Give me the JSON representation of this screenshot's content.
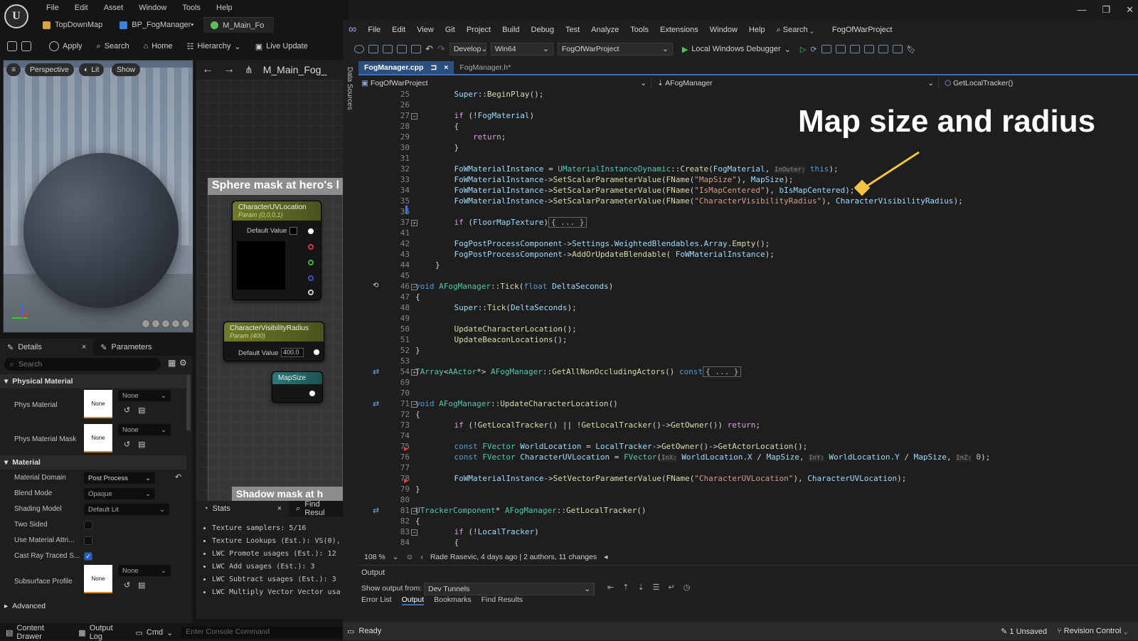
{
  "ue": {
    "menu": [
      "File",
      "Edit",
      "Asset",
      "Window",
      "Tools",
      "Help"
    ],
    "tabs": [
      {
        "label": "TopDownMap"
      },
      {
        "label": "BP_FogManager•"
      },
      {
        "label": "M_Main_Fo"
      }
    ],
    "toolbar": {
      "apply": "Apply",
      "search": "Search",
      "home": "Home",
      "hierarchy": "Hierarchy",
      "live_update": "Live Update"
    },
    "viewport": {
      "perspective": "Perspective",
      "lit": "Lit",
      "show": "Show"
    },
    "graph": {
      "title": "M_Main_Fog_",
      "comment": "Sphere mask at hero's l",
      "nodes": [
        {
          "title": "CharacterUVLocation",
          "sub": "Param (0,0,0,1)",
          "field_label": "Default Value",
          "field_value": ""
        },
        {
          "title": "CharacterVisibilityRadius",
          "sub": "Param (400)",
          "field_label": "Default Value",
          "field_value": "400.0"
        },
        {
          "title": "MapSize",
          "sub": "",
          "field_label": "",
          "field_value": ""
        }
      ],
      "shadow_comment": "Shadow mask at h"
    },
    "details": {
      "tab_details": "Details",
      "tab_parameters": "Parameters",
      "search_placeholder": "Search",
      "physical_material": "Physical Material",
      "phys_material": "Phys Material",
      "phys_material_mask": "Phys Material Mask",
      "none": "None",
      "material": "Material",
      "material_domain": "Material Domain",
      "material_domain_value": "Post Process",
      "blend_mode": "Blend Mode",
      "blend_mode_value": "Opaque",
      "shading_model": "Shading Model",
      "shading_model_value": "Default Lit",
      "two_sided": "Two Sided",
      "use_material_attr": "Use Material Attri...",
      "cast_ray_traced": "Cast Ray Traced S...",
      "subsurface_profile": "Subsurface Profile",
      "advanced": "Advanced"
    },
    "stats": {
      "tab_stats": "Stats",
      "tab_find": "Find Resul",
      "lines": [
        "Texture samplers: 5/16",
        "Texture Lookups (Est.): VS(0),",
        "LWC Promote usages (Est.): 12",
        "LWC Add usages (Est.): 3",
        "LWC Subtract usages (Est.): 3",
        "LWC Multiply Vector Vector usa"
      ]
    },
    "status": {
      "content_drawer": "Content Drawer",
      "output_log": "Output Log",
      "cmd": "Cmd",
      "console_placeholder": "Enter Console Command"
    }
  },
  "vs": {
    "menu": [
      "File",
      "Edit",
      "View",
      "Git",
      "Project",
      "Build",
      "Debug",
      "Test",
      "Analyze",
      "Tools",
      "Extensions",
      "Window",
      "Help"
    ],
    "search": "Search",
    "solution": "FogOfWarProject",
    "toolbar": {
      "config": "Develop",
      "platform": "Win64",
      "project": "FogOfWarProject",
      "debugger": "Local Windows Debugger"
    },
    "side_strip": "Data Sources",
    "doc_tabs": [
      {
        "label": "FogManager.cpp",
        "pin": "⊐",
        "close": "×"
      },
      {
        "label": "FogManager.h*"
      }
    ],
    "nav": {
      "project": "FogOfWarProject",
      "class": "AFogManager",
      "member": "GetLocalTracker()"
    },
    "overlay_title": "Map size and radius",
    "zoom": "108 %",
    "git_info": "Rade Rasevic, 4 days ago | 2 authors, 11 changes",
    "output": {
      "title": "Output",
      "show_from_label": "Show output from:",
      "show_from_value": "Dev Tunnels",
      "tabs": [
        "Error List",
        "Output",
        "Bookmarks",
        "Find Results"
      ]
    },
    "status": {
      "ready": "Ready",
      "unsaved": "1 Unsaved",
      "revision_control": "Revision Control"
    },
    "line_numbers": [
      "25",
      "26",
      "27",
      "28",
      "29",
      "30",
      "31",
      "32",
      "33",
      "34",
      "35",
      "36",
      "37",
      "41",
      "42",
      "43",
      "44",
      "45",
      "46",
      "47",
      "48",
      "49",
      "50",
      "51",
      "52",
      "53",
      "54",
      "69",
      "70",
      "71",
      "72",
      "73",
      "74",
      "75",
      "76",
      "77",
      "78",
      "79",
      "80",
      "81",
      "82",
      "83",
      "84"
    ]
  }
}
